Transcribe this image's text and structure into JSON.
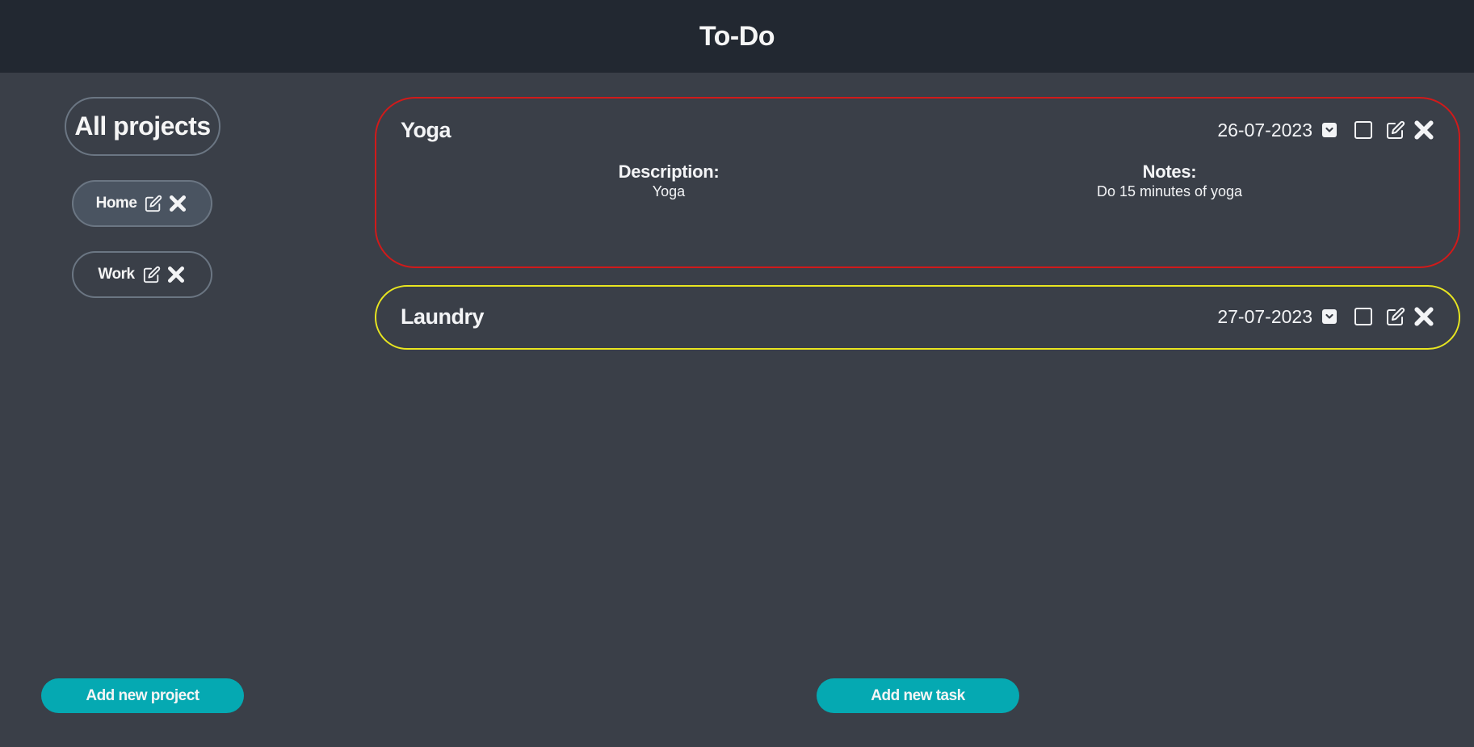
{
  "app": {
    "title": "To-Do"
  },
  "sidebar": {
    "all_projects_label": "All projects",
    "projects": [
      {
        "label": "Home",
        "selected": true
      },
      {
        "label": "Work",
        "selected": false
      }
    ],
    "add_project_label": "Add new project"
  },
  "tasks": [
    {
      "title": "Yoga",
      "date": "26-07-2023",
      "priority": "high",
      "priority_color": "#d11a1a",
      "expanded": true,
      "description_heading": "Description:",
      "description": "Yoga",
      "notes_heading": "Notes:",
      "notes": "Do 15 minutes of yoga"
    },
    {
      "title": "Laundry",
      "date": "27-07-2023",
      "priority": "medium",
      "priority_color": "#e8e620",
      "expanded": false
    }
  ],
  "main": {
    "add_task_label": "Add new task"
  },
  "icons": {
    "edit": "edit-icon",
    "delete": "close-icon",
    "expand": "chevron-down-icon",
    "complete": "checkbox-icon"
  },
  "colors": {
    "header_bg": "#222831",
    "page_bg": "#3a3f48",
    "accent": "#05a9b2"
  }
}
